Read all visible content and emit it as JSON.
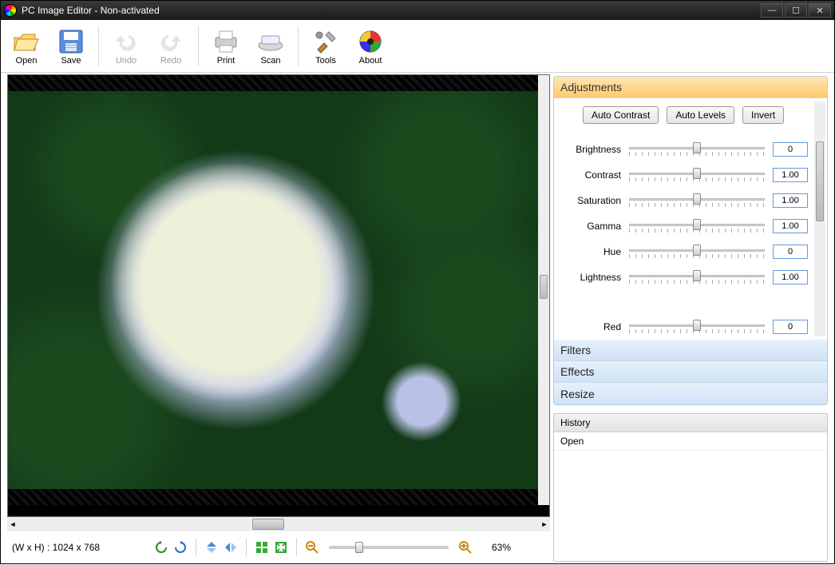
{
  "window": {
    "title": "PC Image Editor - Non-activated"
  },
  "toolbar": {
    "open": "Open",
    "save": "Save",
    "undo": "Undo",
    "redo": "Redo",
    "print": "Print",
    "scan": "Scan",
    "tools": "Tools",
    "about": "About"
  },
  "status": {
    "dimensions_label": "(W x H) : 1024 x 768",
    "zoom_pct": "63%"
  },
  "panels": {
    "adjustments": {
      "title": "Adjustments"
    },
    "filters": {
      "title": "Filters"
    },
    "effects": {
      "title": "Effects"
    },
    "resize": {
      "title": "Resize"
    }
  },
  "adjustments": {
    "auto_contrast": "Auto Contrast",
    "auto_levels": "Auto Levels",
    "invert": "Invert",
    "sliders": {
      "brightness": {
        "label": "Brightness",
        "value": "0",
        "pos": 50
      },
      "contrast": {
        "label": "Contrast",
        "value": "1.00",
        "pos": 50
      },
      "saturation": {
        "label": "Saturation",
        "value": "1.00",
        "pos": 50
      },
      "gamma": {
        "label": "Gamma",
        "value": "1.00",
        "pos": 50
      },
      "hue": {
        "label": "Hue",
        "value": "0",
        "pos": 50
      },
      "lightness": {
        "label": "Lightness",
        "value": "1.00",
        "pos": 50
      },
      "red": {
        "label": "Red",
        "value": "0",
        "pos": 50
      }
    }
  },
  "history": {
    "header": "History",
    "items": [
      "Open"
    ]
  }
}
